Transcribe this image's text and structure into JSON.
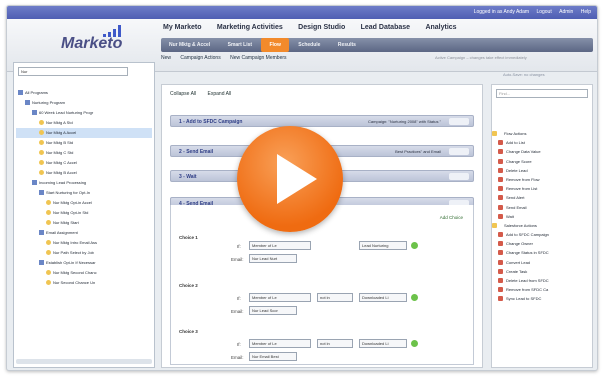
{
  "top_links": [
    "Logged in as Andy Adam",
    "Logout",
    "Admin",
    "Help"
  ],
  "logo": "Marketo",
  "main_nav": [
    "My Marketo",
    "Marketing Activities",
    "Design Studio",
    "Lead Database",
    "Analytics"
  ],
  "sub_tabs": [
    {
      "label": "Nur Mktg & Accel",
      "active": false
    },
    {
      "label": "Smart List",
      "active": false
    },
    {
      "label": "Flow",
      "active": true
    },
    {
      "label": "Schedule",
      "active": false
    },
    {
      "label": "Results",
      "active": false
    }
  ],
  "toolbar": {
    "new": "New",
    "campaign_actions": "Campaign Actions",
    "new_campaign_members": "New Campaign Members",
    "warning": "Active Campaign – changes take effect immediately"
  },
  "left": {
    "search_value": "Nur",
    "tree": [
      {
        "label": "All Programs",
        "level": 0,
        "kind": "folder"
      },
      {
        "label": "Nurturing Program",
        "level": 1,
        "kind": "folder"
      },
      {
        "label": "60 Week Lead Nurturing Progr",
        "level": 2,
        "kind": "folder"
      },
      {
        "label": "Nur Mktg A Std",
        "level": 3,
        "kind": "campaign"
      },
      {
        "label": "Nur Mktg A Accel",
        "level": 3,
        "kind": "campaign",
        "selected": true
      },
      {
        "label": "Nur Mktg B Std",
        "level": 3,
        "kind": "campaign"
      },
      {
        "label": "Nur Mktg C Std",
        "level": 3,
        "kind": "campaign"
      },
      {
        "label": "Nur Mktg C Accel",
        "level": 3,
        "kind": "campaign"
      },
      {
        "label": "Nur Mktg B Accel",
        "level": 3,
        "kind": "campaign"
      },
      {
        "label": "Incoming Lead Processing",
        "level": 2,
        "kind": "folder"
      },
      {
        "label": "Start Nurturing for Opt-In",
        "level": 3,
        "kind": "folder"
      },
      {
        "label": "Nur Mktg Opt-in Accel",
        "level": 4,
        "kind": "campaign"
      },
      {
        "label": "Nur Mktg Opt-in Std",
        "level": 4,
        "kind": "campaign"
      },
      {
        "label": "Nur Mktg Start",
        "level": 4,
        "kind": "campaign"
      },
      {
        "label": "Email Assignment",
        "level": 3,
        "kind": "folder"
      },
      {
        "label": "Nur Mktg Intro Email Ass",
        "level": 4,
        "kind": "campaign"
      },
      {
        "label": "Nur Path Select by Job",
        "level": 4,
        "kind": "campaign"
      },
      {
        "label": "Establish Opt-in If Necessar",
        "level": 3,
        "kind": "folder"
      },
      {
        "label": "Nur Mktg Second Chanc",
        "level": 4,
        "kind": "campaign"
      },
      {
        "label": "Nur Second Chance Un",
        "level": 4,
        "kind": "campaign"
      }
    ]
  },
  "center": {
    "collapse_all": "Collapse All",
    "expand_all": "Expand All",
    "steps": [
      {
        "title": "1 - Add to SFDC Campaign",
        "detail": "Campaign: \"Nurturing 2008\" with Status \""
      },
      {
        "title": "2 - Send Email",
        "detail": "Best Practices\" and Email"
      },
      {
        "title": "3 - Wait",
        "detail": ""
      },
      {
        "title": "4 - Send Email",
        "detail": ""
      }
    ],
    "add_choice": "Add Choice",
    "if_label": "If:",
    "email_label": "Email:",
    "choices": [
      {
        "label": "Choice 1",
        "field": "Member of Le",
        "op": "",
        "value": "Lead Nurturing",
        "email": "Nur Lead Nurt"
      },
      {
        "label": "Choice 2",
        "field": "Member of Le",
        "op": "not in",
        "value": "Downloaded Li",
        "email": "Nur Lead Scor"
      },
      {
        "label": "Choice 3",
        "field": "Member of Le",
        "op": "not in",
        "value": "Downloaded Li",
        "email": "Nur Email Best"
      }
    ]
  },
  "right": {
    "autosave": "Auto-Save: no changes",
    "search_placeholder": "Find...",
    "items": [
      {
        "label": "Flow Actions",
        "header": true
      },
      {
        "label": "Add to List"
      },
      {
        "label": "Change Data Value"
      },
      {
        "label": "Change Score"
      },
      {
        "label": "Delete Lead"
      },
      {
        "label": "Remove from Flow"
      },
      {
        "label": "Remove from List"
      },
      {
        "label": "Send Alert"
      },
      {
        "label": "Send Email"
      },
      {
        "label": "Wait"
      },
      {
        "label": "Salesforce Actions",
        "header": true
      },
      {
        "label": "Add to SFDC Campaign"
      },
      {
        "label": "Change Owner"
      },
      {
        "label": "Change Status in SFDC"
      },
      {
        "label": "Convert Lead"
      },
      {
        "label": "Create Task"
      },
      {
        "label": "Delete Lead from SFDC"
      },
      {
        "label": "Remove from SFDC Ca"
      },
      {
        "label": "Sync Lead to SFDC"
      }
    ]
  },
  "colors": {
    "accent": "#f28a2b",
    "play": "#ef6b11",
    "topbar": "#5464b8",
    "link": "#2f3e86"
  }
}
